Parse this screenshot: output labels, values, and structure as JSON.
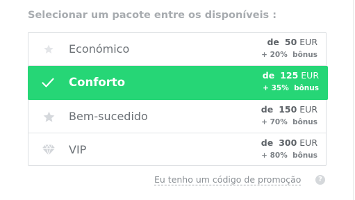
{
  "heading": "Selecionar um pacote entre os disponíveis :",
  "packages": [
    {
      "name": "Económico",
      "icon": "star-icon",
      "price_prefix": "de",
      "amount": "50",
      "currency": "EUR",
      "bonus_percent": "+ 20%",
      "bonus_label": "bônus",
      "selected": false
    },
    {
      "name": "Conforto",
      "icon": "checkmark-icon",
      "price_prefix": "de",
      "amount": "125",
      "currency": "EUR",
      "bonus_percent": "+ 35%",
      "bonus_label": "bônus",
      "selected": true
    },
    {
      "name": "Bem-sucedido",
      "icon": "star-icon",
      "price_prefix": "de",
      "amount": "150",
      "currency": "EUR",
      "bonus_percent": "+ 70%",
      "bonus_label": "bônus",
      "selected": false
    },
    {
      "name": "VIP",
      "icon": "diamond-icon",
      "price_prefix": "de",
      "amount": "300",
      "currency": "EUR",
      "bonus_percent": "+ 80%",
      "bonus_label": "bônus",
      "selected": false
    }
  ],
  "promo_link": "Eu tenho um código de promoção",
  "help_icon": "?",
  "colors": {
    "selected_bg": "#26d676",
    "heading": "#a7abaf",
    "icon_gray": "#dcdfe2"
  }
}
